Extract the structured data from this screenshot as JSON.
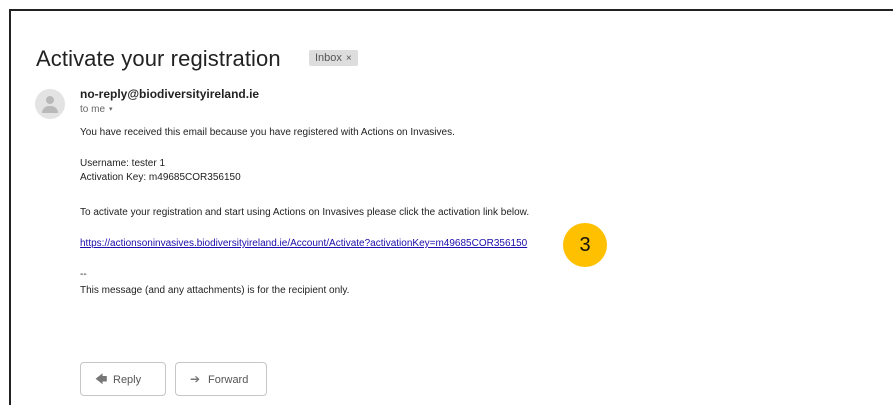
{
  "email": {
    "subject": "Activate your registration",
    "label": "Inbox",
    "label_close": "×",
    "sender": "no-reply@biodiversityireland.ie",
    "recipient": "to me",
    "recipient_caret": "▾",
    "body": {
      "intro": "You have received this email because you have registered with Actions on Invasives.",
      "username": "Username: tester 1",
      "activation_key": "Activation Key: m49685COR356150",
      "instruction": "To activate your registration and start using Actions on Invasives please click the activation link below.",
      "link": "https://actionsoninvasives.biodiversityireland.ie/Account/Activate?activationKey=m49685COR356150",
      "separator": "--",
      "footer": "This message (and any attachments) is for the recipient only."
    }
  },
  "annotation": {
    "step_number": "3",
    "color": "#ffc000"
  },
  "actions": {
    "reply_label": "Reply",
    "reply_icon": "reply-icon",
    "forward_label": "Forward",
    "forward_icon": "forward-icon"
  }
}
